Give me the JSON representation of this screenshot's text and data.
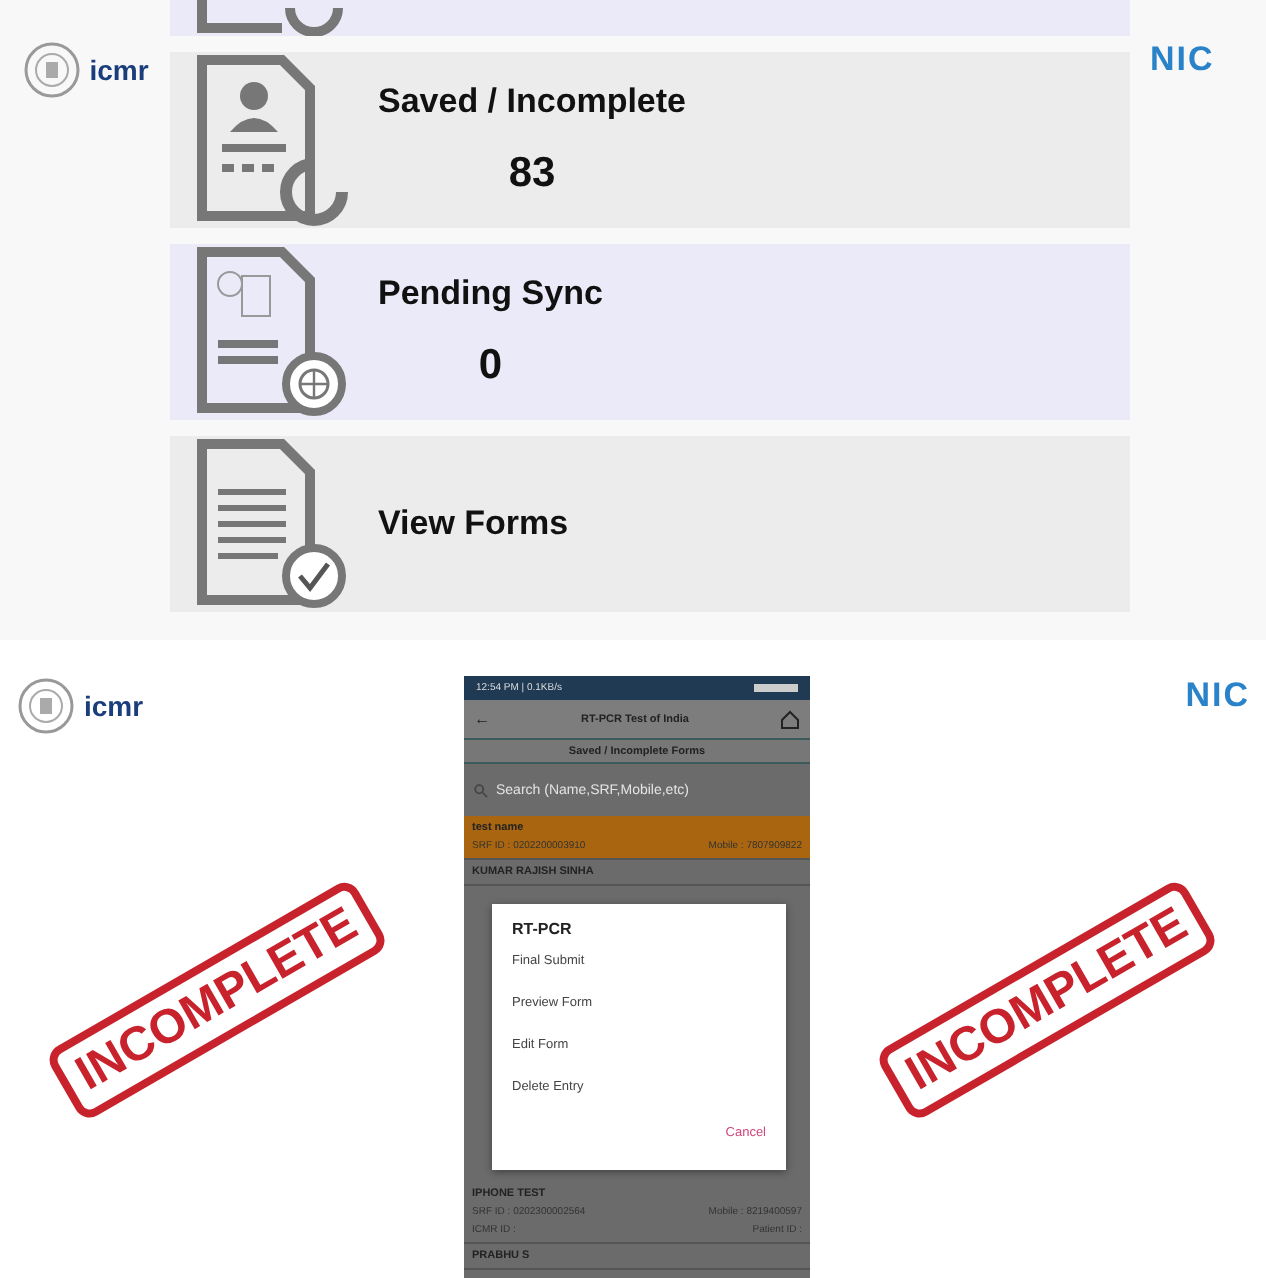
{
  "top_slide": {
    "logos": {
      "left": "icmr",
      "right": "NIC"
    },
    "cards": [
      {
        "kind": "partial"
      },
      {
        "kind": "saved",
        "title": "Saved / Incomplete",
        "value": "83"
      },
      {
        "kind": "sync",
        "title": "Pending Sync",
        "value": "0"
      },
      {
        "kind": "forms",
        "title": "View Forms"
      }
    ]
  },
  "bottom_slide": {
    "logos": {
      "left": "icmr",
      "right": "NIC"
    },
    "stamps": [
      "INCOMPLETE",
      "INCOMPLETE"
    ],
    "phone": {
      "status_time": "12:54 PM | 0.1KB/s",
      "back": "←",
      "app_title": "RT-PCR Test of India",
      "subtitle": "Saved / Incomplete Forms",
      "search": {
        "placeholder": "Search (Name,SRF,Mobile,etc)"
      },
      "rows_top": [
        {
          "name": "test name",
          "srf_label": "SRF ID :",
          "srf": "0202200003910",
          "mobile_label": "Mobile :",
          "mobile": "7807909822",
          "selected": true
        },
        {
          "name": "KUMAR RAJISH SINHA",
          "selected": false
        }
      ],
      "rows_bottom": [
        {
          "name": "IPHONE TEST",
          "srf_label": "SRF ID :",
          "srf": "0202300002564",
          "mobile_label": "Mobile :",
          "mobile": "8219400597",
          "icmr_label": "ICMR ID :",
          "patient_label": "Patient ID :",
          "selected": false
        },
        {
          "name": "PRABHU S",
          "selected": false
        }
      ],
      "dialog": {
        "title": "RT-PCR",
        "options": [
          "Final Submit",
          "Preview Form",
          "Edit Form",
          "Delete Entry"
        ],
        "cancel": "Cancel"
      }
    }
  }
}
